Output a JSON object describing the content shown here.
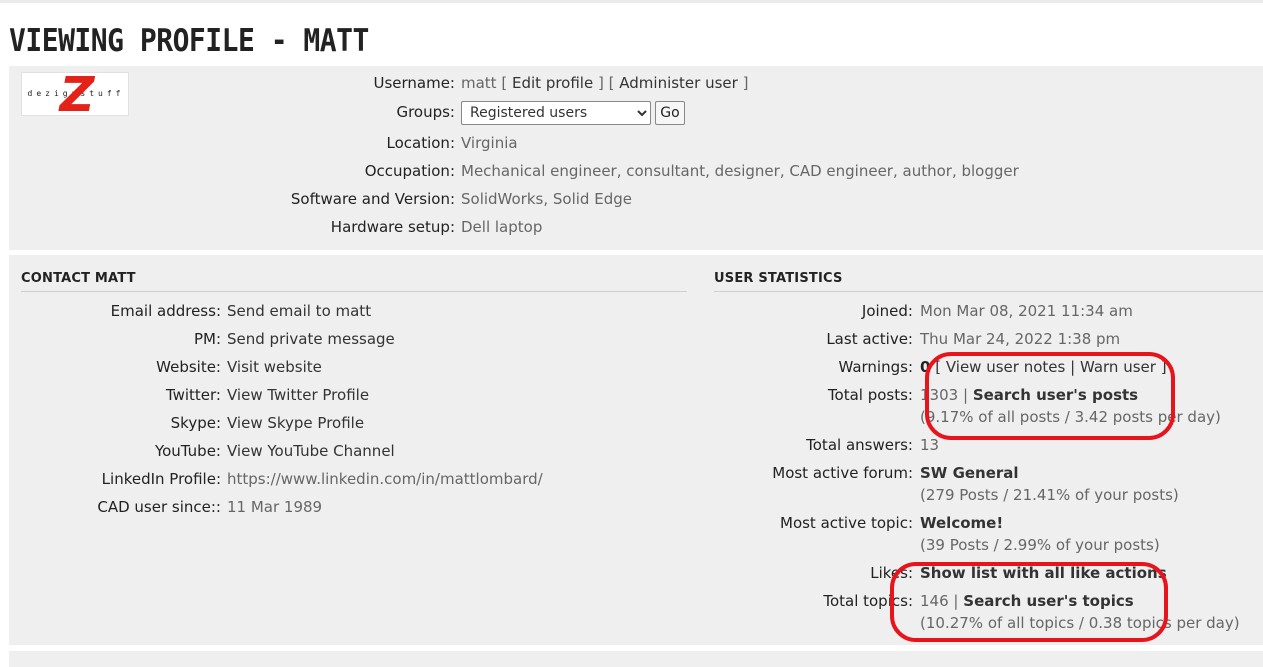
{
  "page_title": "VIEWING PROFILE - MATT",
  "logo": {
    "brand_text": "dezignstuff",
    "letter": "Z"
  },
  "profile": {
    "username_label": "Username:",
    "username": "matt",
    "edit_profile": "Edit profile",
    "administer_user": "Administer user",
    "bracket_open": "[",
    "bracket_close": "]",
    "groups_label": "Groups:",
    "groups_selected": "Registered users",
    "go_label": "Go",
    "location_label": "Location:",
    "location": "Virginia",
    "occupation_label": "Occupation:",
    "occupation": "Mechanical engineer, consultant, designer, CAD engineer, author, blogger",
    "software_label": "Software and Version:",
    "software": "SolidWorks, Solid Edge",
    "hardware_label": "Hardware setup:",
    "hardware": "Dell laptop"
  },
  "contact": {
    "heading": "CONTACT MATT",
    "email_label": "Email address:",
    "email": "Send email to matt",
    "pm_label": "PM:",
    "pm": "Send private message",
    "website_label": "Website:",
    "website": "Visit website",
    "twitter_label": "Twitter:",
    "twitter": "View Twitter Profile",
    "skype_label": "Skype:",
    "skype": "View Skype Profile",
    "youtube_label": "YouTube:",
    "youtube": "View YouTube Channel",
    "linkedin_label": "LinkedIn Profile:",
    "linkedin": "https://www.linkedin.com/in/mattlombard/",
    "cad_label": "CAD user since::",
    "cad": "11 Mar 1989"
  },
  "stats": {
    "heading": "USER STATISTICS",
    "joined_label": "Joined:",
    "joined": "Mon Mar 08, 2021 11:34 am",
    "last_active_label": "Last active:",
    "last_active": "Thu Mar 24, 2022 1:38 pm",
    "warnings_label": "Warnings:",
    "warnings": "0",
    "view_user_notes": "View user notes",
    "warn_user": "Warn user",
    "sep": "|",
    "total_posts_label": "Total posts:",
    "total_posts": "1303",
    "search_posts": "Search user's posts",
    "posts_detail": "(9.17% of all posts / 3.42 posts per day)",
    "total_answers_label": "Total answers:",
    "total_answers": "13",
    "active_forum_label": "Most active forum:",
    "active_forum": "SW General",
    "active_forum_detail": "(279 Posts / 21.41% of your posts)",
    "active_topic_label": "Most active topic:",
    "active_topic": "Welcome!",
    "active_topic_detail": "(39 Posts / 2.99% of your posts)",
    "likes_label": "Likes:",
    "likes_link": "Show list with all like actions",
    "total_topics_label": "Total topics:",
    "total_topics": "146",
    "search_topics": "Search user's topics",
    "topics_detail": "(10.27% of all topics / 0.38 topics per day)"
  },
  "colors": {
    "annotation": "#e8141c",
    "panel": "#efefef",
    "logo_red": "#e32219"
  }
}
